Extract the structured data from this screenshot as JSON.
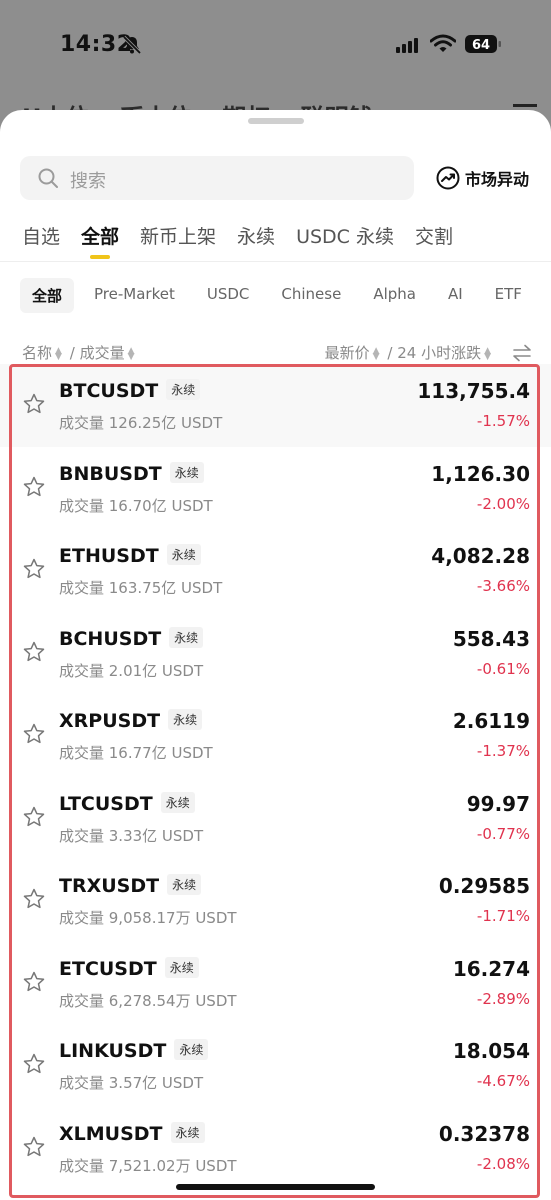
{
  "status_bar": {
    "time": "14:32",
    "battery": "64"
  },
  "background_tabs": [
    "U本位",
    "币本位",
    "期权",
    "聪明钱"
  ],
  "search": {
    "placeholder": "搜索"
  },
  "market_alert": {
    "label": "市场异动"
  },
  "main_tabs": [
    {
      "label": "自选",
      "active": false
    },
    {
      "label": "全部",
      "active": true
    },
    {
      "label": "新币上架",
      "active": false
    },
    {
      "label": "永续",
      "active": false
    },
    {
      "label": "USDC 永续",
      "active": false
    },
    {
      "label": "交割",
      "active": false
    }
  ],
  "sub_tabs": [
    {
      "label": "全部",
      "active": true
    },
    {
      "label": "Pre-Market",
      "active": false
    },
    {
      "label": "USDC",
      "active": false
    },
    {
      "label": "Chinese",
      "active": false
    },
    {
      "label": "Alpha",
      "active": false
    },
    {
      "label": "AI",
      "active": false
    },
    {
      "label": "ETF",
      "active": false
    }
  ],
  "columns": {
    "name": "名称",
    "volume": "成交量",
    "price": "最新价",
    "change": "24 小时涨跌",
    "sep": "/"
  },
  "tickers": [
    {
      "symbol": "BTCUSDT",
      "badge": "永续",
      "volume": "成交量 126.25亿 USDT",
      "price": "113,755.4",
      "change": "-1.57%"
    },
    {
      "symbol": "BNBUSDT",
      "badge": "永续",
      "volume": "成交量 16.70亿 USDT",
      "price": "1,126.30",
      "change": "-2.00%"
    },
    {
      "symbol": "ETHUSDT",
      "badge": "永续",
      "volume": "成交量 163.75亿 USDT",
      "price": "4,082.28",
      "change": "-3.66%"
    },
    {
      "symbol": "BCHUSDT",
      "badge": "永续",
      "volume": "成交量 2.01亿 USDT",
      "price": "558.43",
      "change": "-0.61%"
    },
    {
      "symbol": "XRPUSDT",
      "badge": "永续",
      "volume": "成交量 16.77亿 USDT",
      "price": "2.6119",
      "change": "-1.37%"
    },
    {
      "symbol": "LTCUSDT",
      "badge": "永续",
      "volume": "成交量 3.33亿 USDT",
      "price": "99.97",
      "change": "-0.77%"
    },
    {
      "symbol": "TRXUSDT",
      "badge": "永续",
      "volume": "成交量 9,058.17万 USDT",
      "price": "0.29585",
      "change": "-1.71%"
    },
    {
      "symbol": "ETCUSDT",
      "badge": "永续",
      "volume": "成交量 6,278.54万 USDT",
      "price": "16.274",
      "change": "-2.89%"
    },
    {
      "symbol": "LINKUSDT",
      "badge": "永续",
      "volume": "成交量 3.57亿 USDT",
      "price": "18.054",
      "change": "-4.67%"
    },
    {
      "symbol": "XLMUSDT",
      "badge": "永续",
      "volume": "成交量 7,521.02万 USDT",
      "price": "0.32378",
      "change": "-2.08%"
    }
  ],
  "colors": {
    "accent": "#f0c419",
    "negative": "#e0334e",
    "highlight_border": "#e05a5f"
  }
}
